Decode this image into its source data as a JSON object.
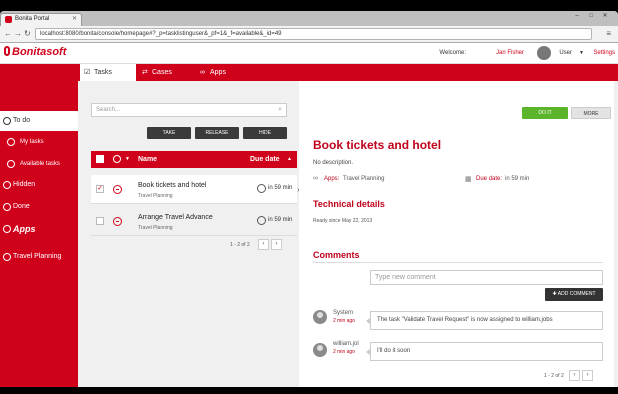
{
  "browser": {
    "tab_title": "Bonita Portal",
    "url": "localhost:8080/bonita/console/homepage#?_p=tasklistinguser&_pf=1&_f=available&_id=49",
    "back_icon": "arrow-left-icon",
    "forward_icon": "arrow-right-icon",
    "reload_icon": "reload-icon"
  },
  "header": {
    "logo": "Bonitasoft",
    "welcome": "Welcome:",
    "user_name": "Jan Fisher",
    "user_label": "User",
    "settings": "Settings"
  },
  "nav": {
    "tabs": [
      {
        "label": "Tasks",
        "icon": "check-square-icon",
        "active": true
      },
      {
        "label": "Cases",
        "icon": "shuffle-icon",
        "active": false
      },
      {
        "label": "Apps",
        "icon": "link-icon",
        "active": false
      }
    ]
  },
  "sidebar": {
    "items": [
      {
        "label": "To do"
      },
      {
        "label": "My tasks"
      },
      {
        "label": "Available tasks"
      },
      {
        "label": "Hidden"
      },
      {
        "label": "Done"
      },
      {
        "label": "Apps"
      },
      {
        "label": "Travel Planning"
      }
    ]
  },
  "list": {
    "search_placeholder": "Search...",
    "actions": {
      "take": "TAKE",
      "release": "RELEASE",
      "hide": "HIDE"
    },
    "col_name": "Name",
    "col_due": "Due date",
    "rows": [
      {
        "name": "Book tickets and hotel",
        "app": "Travel Planning",
        "due": "in 59 min",
        "checked": true
      },
      {
        "name": "Arrange Travel Advance",
        "app": "Travel Planning",
        "due": "in 59 min",
        "checked": false
      }
    ],
    "pager": "1 - 2 of 2"
  },
  "detail": {
    "do_it": "DO IT",
    "more": "MORE",
    "title": "Book tickets and hotel",
    "description": "No description.",
    "apps_label": "Apps:",
    "apps_value": "Travel Planning",
    "due_label": "Due date:",
    "due_value": "in 59 min",
    "tech_heading": "Technical details",
    "ready_since": "Ready since May 22, 2013",
    "comments_heading": "Comments",
    "new_comment_placeholder": "Type new comment",
    "add_comment": "ADD COMMENT",
    "comments": [
      {
        "author": "System",
        "time": "2 min ago",
        "text": "The task \"Validate Travel Request\" is now assigned to william.jobs"
      },
      {
        "author": "william.jol",
        "time": "2 min ago",
        "text": "I'll do it soon"
      }
    ],
    "pager": "1 - 2 of 2"
  },
  "colors": {
    "brand_red": "#d0021b",
    "do_it_green": "#5bb42a"
  }
}
